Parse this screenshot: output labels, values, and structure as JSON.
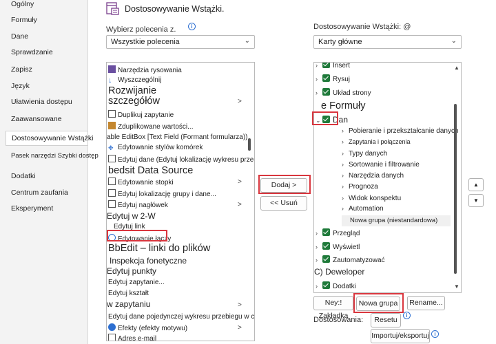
{
  "nav": {
    "items": [
      {
        "label": "Ogólny"
      },
      {
        "label": "Formuły"
      },
      {
        "label": "Dane"
      },
      {
        "label": "Sprawdzanie"
      },
      {
        "label": "Zapisz"
      },
      {
        "label": "Język"
      },
      {
        "label": "Ułatwienia dostępu"
      },
      {
        "label": "Zaawansowane"
      },
      {
        "label": "Dostosowywanie Wstążki"
      },
      {
        "label": "Pasek narzędzi Szybki dostęp"
      },
      {
        "label": "Dodatki"
      },
      {
        "label": "Centrum zaufania"
      },
      {
        "label": "Eksperyment"
      }
    ]
  },
  "header": {
    "title": "Dostosowywanie Wstążki.",
    "icon": "customize-ribbon-icon"
  },
  "left": {
    "label": "Wybierz polecenia z.",
    "combo_value": "Wszystkie polecenia",
    "commands": [
      {
        "label": "Narzędzia rysowania"
      },
      {
        "label": "Wyszczególnij"
      },
      {
        "label": "Rozwijanie"
      },
      {
        "label": "szczegółów"
      },
      {
        "label": "Duplikuj zapytanie"
      },
      {
        "label": "Zduplikowane wartości..."
      },
      {
        "label": "able EditBox [Text Field (Formant formularza))"
      },
      {
        "label": "Edytowanie stylów komórek"
      },
      {
        "label": "Edytuj dane (Edytuj lokalizację wykresu przebiegu w czasie"
      },
      {
        "label": "bedsit Data Source"
      },
      {
        "label": "Edytowanie stopki"
      },
      {
        "label": "Edytuj lokalizację grupy i dane..."
      },
      {
        "label": "Edytuj nagłówek"
      },
      {
        "label": "Edytuj w 2-W"
      },
      {
        "label": "Edytuj link"
      },
      {
        "label": "Edytowanie łączy"
      },
      {
        "label": "BbEdit – linki do plików"
      },
      {
        "label": "Inspekcja fonetyczne"
      },
      {
        "label": "Edytuj punkty"
      },
      {
        "label": "Edytuj zapytanie..."
      },
      {
        "label": "Edytuj kształt"
      },
      {
        "label": "w zapytaniu"
      },
      {
        "label": "Edytuj dane pojedynczej wykresu przebiegu w czasie..."
      },
      {
        "label": "Efekty (efekty motywu)"
      },
      {
        "label": "Adres e-mail"
      }
    ]
  },
  "middle": {
    "add_label": "Dodaj >",
    "remove_label": "<< Usuń"
  },
  "right": {
    "label": "Dostosowywanie Wstążki: @",
    "combo_value": "Karty główne",
    "tabs": [
      {
        "label": "Insert"
      },
      {
        "label": "Rysuj"
      },
      {
        "label": "Układ strony"
      },
      {
        "label": "e Formuły"
      },
      {
        "label": "Dan"
      },
      {
        "label": "Pobieranie i przekształcanie danych"
      },
      {
        "label": "Zapytania i połączenia"
      },
      {
        "label": "Typy danych"
      },
      {
        "label": "Sortowanie i filtrowanie"
      },
      {
        "label": "Narzędzia danych"
      },
      {
        "label": "Prognoza"
      },
      {
        "label": "Widok konspektu"
      },
      {
        "label": "Automation"
      },
      {
        "label": "Nowa grupa (niestandardowa)"
      },
      {
        "label": "Przegląd"
      },
      {
        "label": "Wyświetl"
      },
      {
        "label": "Zautomatyzować"
      },
      {
        "label": "C) Deweloper"
      },
      {
        "label": "Dodatki"
      }
    ],
    "new_tab_label": "Ney:! Zakładka",
    "new_group_label": "Nowa grupa",
    "rename_label": "Rename...",
    "customizations_label": "Dostosowania:",
    "reset_label": "Resetu",
    "import_export_label": "Importuj/eksportuj"
  }
}
